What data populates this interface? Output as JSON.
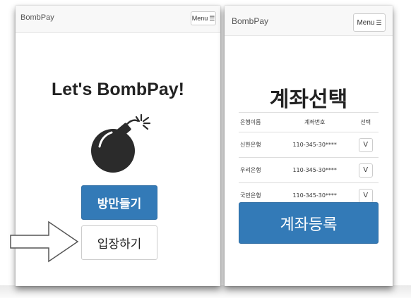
{
  "left_screen": {
    "brand": "BombPay",
    "menu_label": "Menu",
    "title": "Let's BombPay!",
    "create_room_button": "방만들기",
    "enter_room_button": "입장하기"
  },
  "right_screen": {
    "brand": "BombPay",
    "menu_label": "Menu",
    "title": "계좌선택",
    "table": {
      "headers": [
        "은행이름",
        "계좌번호",
        "선택"
      ],
      "rows": [
        {
          "bank": "신한은행",
          "account": "110-345-30****",
          "select": "V"
        },
        {
          "bank": "우리은행",
          "account": "110-345-30****",
          "select": "V"
        },
        {
          "bank": "국민은행",
          "account": "110-345-30****",
          "select": "V"
        }
      ]
    },
    "register_button": "계좌등록"
  },
  "colors": {
    "primary": "#337ab7",
    "navbar_bg": "#f8f8f8",
    "bomb": "#2b2b2b"
  }
}
